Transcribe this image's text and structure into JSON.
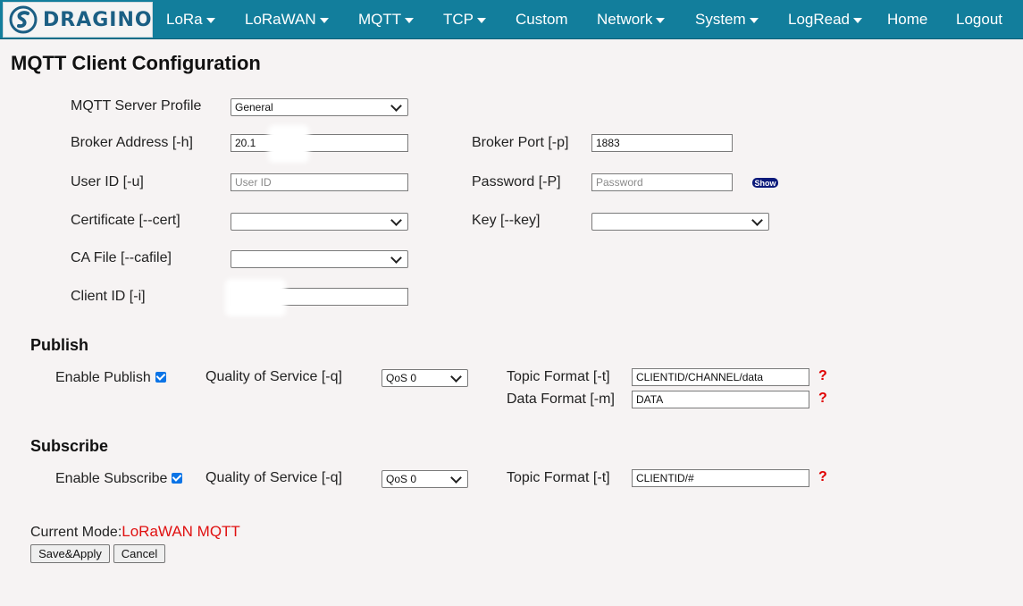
{
  "brand": {
    "logo_text": "DRAGINO",
    "logo_icon": "dragino-swirl-icon"
  },
  "nav": [
    {
      "label": "LoRa",
      "has_dropdown": true
    },
    {
      "label": "LoRaWAN",
      "has_dropdown": true
    },
    {
      "label": "MQTT",
      "has_dropdown": true
    },
    {
      "label": "TCP",
      "has_dropdown": true
    },
    {
      "label": "Custom",
      "has_dropdown": false
    },
    {
      "label": "Network",
      "has_dropdown": true
    },
    {
      "label": "System",
      "has_dropdown": true
    },
    {
      "label": "LogRead",
      "has_dropdown": true
    },
    {
      "label": "Home",
      "has_dropdown": false
    },
    {
      "label": "Logout",
      "has_dropdown": false
    }
  ],
  "page": {
    "title": "MQTT Client Configuration"
  },
  "server": {
    "profile_label": "MQTT Server Profile",
    "profile_value": "General",
    "broker_address_label": "Broker Address [-h]",
    "broker_address_value": "20.1",
    "broker_port_label": "Broker Port [-p]",
    "broker_port_value": "1883",
    "user_id_label": "User ID [-u]",
    "user_id_placeholder": "User ID",
    "password_label": "Password [-P]",
    "password_placeholder": "Password",
    "show_label": "Show",
    "certificate_label": "Certificate [--cert]",
    "certificate_value": "",
    "key_label": "Key [--key]",
    "key_value": "",
    "cafile_label": "CA File [--cafile]",
    "cafile_value": "",
    "client_id_label": "Client ID [-i]",
    "client_id_value": ""
  },
  "publish": {
    "title": "Publish",
    "enable_label": "Enable Publish",
    "enabled": true,
    "qos_label": "Quality of Service [-q]",
    "qos_value": "QoS 0",
    "topic_label": "Topic Format [-t]",
    "topic_value": "CLIENTID/CHANNEL/data",
    "data_label": "Data Format [-m]",
    "data_value": "DATA",
    "help_mark": "?"
  },
  "subscribe": {
    "title": "Subscribe",
    "enable_label": "Enable Subscribe",
    "enabled": true,
    "qos_label": "Quality of Service [-q]",
    "qos_value": "QoS 0",
    "topic_label": "Topic Format [-t]",
    "topic_value": "CLIENTID/#",
    "help_mark": "?"
  },
  "status": {
    "mode_label": "Current Mode:",
    "mode_value": "LoRaWAN MQTT"
  },
  "actions": {
    "save_label": "Save&Apply",
    "cancel_label": "Cancel"
  }
}
